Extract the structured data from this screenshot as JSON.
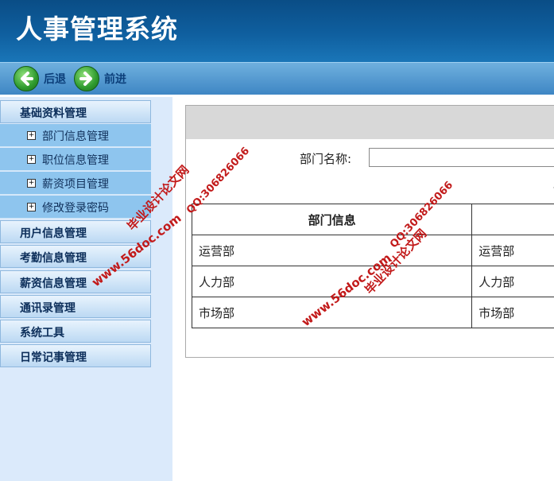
{
  "app": {
    "title": "人事管理系统"
  },
  "toolbar": {
    "back_label": "后退",
    "forward_label": "前进"
  },
  "sidebar": {
    "groups": [
      {
        "label": "基础资料管理",
        "items": [
          {
            "label": "部门信息管理"
          },
          {
            "label": "职位信息管理"
          },
          {
            "label": "薪资项目管理"
          },
          {
            "label": "修改登录密码"
          }
        ]
      },
      {
        "label": "用户信息管理"
      },
      {
        "label": "考勤信息管理"
      },
      {
        "label": "薪资信息管理"
      },
      {
        "label": "通讯录管理"
      },
      {
        "label": "系统工具"
      },
      {
        "label": "日常记事管理"
      }
    ]
  },
  "main": {
    "search": {
      "label": "部门名称:",
      "value": ""
    },
    "clipped_text": "请",
    "table": {
      "headers": [
        "部门信息",
        ""
      ],
      "rows": [
        [
          "运营部",
          "运营部"
        ],
        [
          "人力部",
          "人力部"
        ],
        [
          "市场部",
          "市场部"
        ]
      ]
    }
  },
  "watermark": {
    "site": "www.56doc.com",
    "qq": "QQ:306826066",
    "name": "毕业设计论文网"
  }
}
